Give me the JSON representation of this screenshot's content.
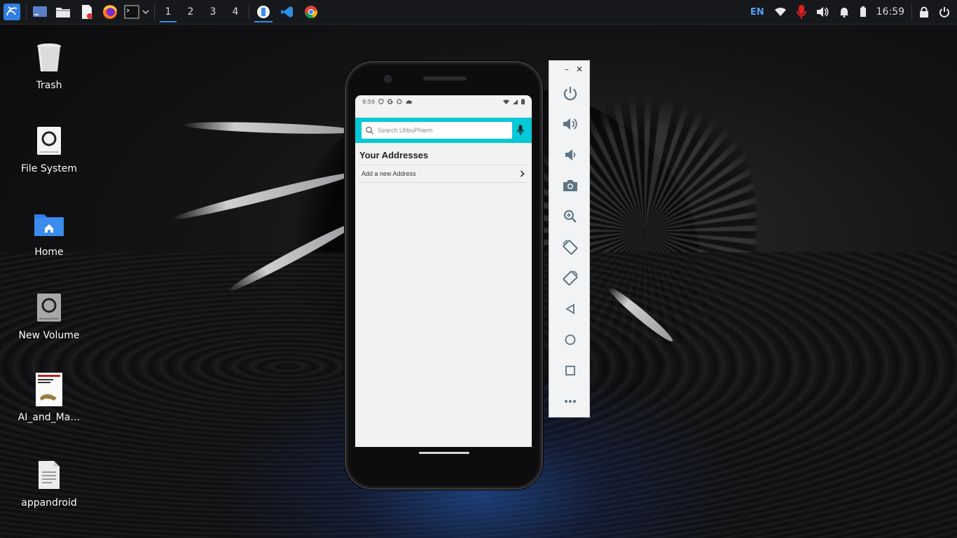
{
  "taskbar": {
    "workspaces": [
      "1",
      "2",
      "3",
      "4"
    ],
    "active_workspace": "1",
    "keyboard_layout": "EN",
    "clock": "16:59"
  },
  "desktop_icons": [
    {
      "label": "Trash",
      "icon": "trash-icon"
    },
    {
      "label": "File System",
      "icon": "drive-icon"
    },
    {
      "label": "Home",
      "icon": "home-folder-icon"
    },
    {
      "label": "New Volume",
      "icon": "drive-icon"
    },
    {
      "label": "AI_and_Ma…",
      "icon": "pdf-thumbnail-icon"
    },
    {
      "label": "appandroid",
      "icon": "text-file-icon"
    }
  ],
  "phone": {
    "status_time": "9:59",
    "search_placeholder": "Search UtibuPharm",
    "section_title": "Your Addresses",
    "add_address_label": "Add a new Address",
    "accent_color": "#06c8d6"
  },
  "emulator_controls": [
    "power",
    "volume-up",
    "volume-down",
    "screenshot",
    "zoom",
    "rotate-left",
    "rotate-right",
    "back",
    "home",
    "overview",
    "more"
  ]
}
